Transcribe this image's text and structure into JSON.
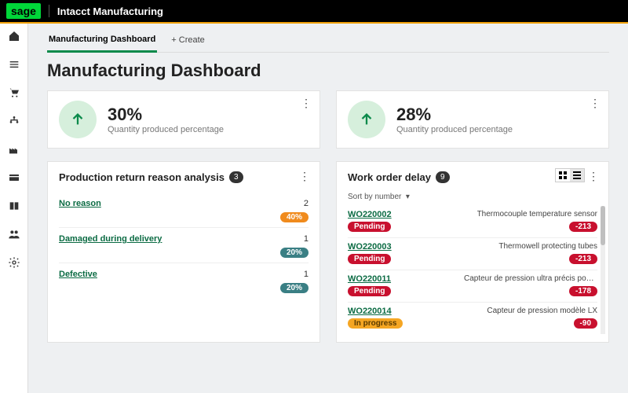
{
  "brand": {
    "logo": "sage",
    "product": "Intacct Manufacturing"
  },
  "tabs": {
    "active": "Manufacturing Dashboard",
    "create": "+ Create"
  },
  "page_title": "Manufacturing Dashboard",
  "kpis": [
    {
      "value": "30%",
      "label": "Quantity produced percentage"
    },
    {
      "value": "28%",
      "label": "Quantity produced percentage"
    }
  ],
  "reasons_panel": {
    "title": "Production return reason analysis",
    "count": "3",
    "rows": [
      {
        "label": "No reason",
        "count": "2",
        "pct": "40%",
        "pill_class": "orange"
      },
      {
        "label": "Damaged during delivery",
        "count": "1",
        "pct": "20%",
        "pill_class": "teal"
      },
      {
        "label": "Defective",
        "count": "1",
        "pct": "20%",
        "pill_class": "teal"
      }
    ]
  },
  "wo_panel": {
    "title": "Work order delay",
    "count": "9",
    "sort_label": "Sort by number",
    "rows": [
      {
        "id": "WO220002",
        "desc": "Thermocouple temperature sensor",
        "status": "Pending",
        "status_class": "red",
        "delay": "-213"
      },
      {
        "id": "WO220003",
        "desc": "Thermowell protecting tubes",
        "status": "Pending",
        "status_class": "red",
        "delay": "-213"
      },
      {
        "id": "WO220011",
        "desc": "Capteur de pression ultra précis pour ba...",
        "status": "Pending",
        "status_class": "red",
        "delay": "-178"
      },
      {
        "id": "WO220014",
        "desc": "Capteur de pression modèle LX",
        "status": "In progress",
        "status_class": "orange2",
        "delay": "-90"
      }
    ]
  }
}
